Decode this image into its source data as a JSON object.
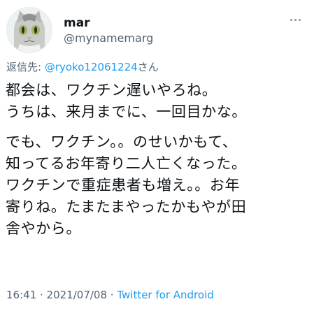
{
  "tweet": {
    "author": {
      "display_name": "mar",
      "handle": "@mynamemarg",
      "avatar": "cat-avatar"
    },
    "more_icon": "more-dots-icon",
    "reply_to": {
      "prefix": "返信先: ",
      "mention": "@ryoko12061224",
      "suffix": "さん"
    },
    "paragraphs": [
      [
        "都会は、ワクチン遅いやろね。",
        "うちは、来月までに、一回目かな。"
      ],
      [
        "でも、ワクチン。。のせいかもて、",
        "知ってるお年寄り二人亡くなった。",
        "ワクチンで重症患者も増え。。お年",
        "寄りね。たまたまやったかもやが田",
        "舎やから。"
      ]
    ],
    "meta": {
      "time": "16:41",
      "sep1": " · ",
      "date": "2021/07/08",
      "sep2": " · ",
      "source": "Twitter for Android"
    },
    "colors": {
      "link": "#1d9bf0",
      "secondary": "#536471",
      "text": "#0f1419"
    }
  }
}
